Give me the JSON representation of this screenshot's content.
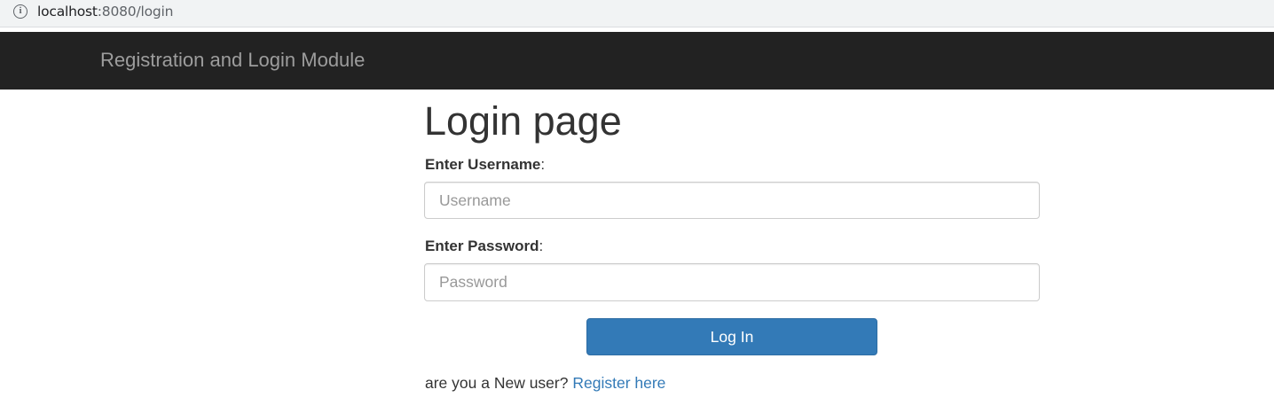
{
  "browser": {
    "url_host": "localhost",
    "url_rest": ":8080/login",
    "info_icon": "info-icon"
  },
  "navbar": {
    "brand": "Registration and Login Module",
    "background": "#222222",
    "brand_color": "#9d9d9d"
  },
  "main": {
    "title": "Login page",
    "username": {
      "label": "Enter Username",
      "colon": ":",
      "placeholder": "Username",
      "value": ""
    },
    "password": {
      "label": "Enter Password",
      "colon": ":",
      "placeholder": "Password",
      "value": ""
    },
    "login_button": "Log In",
    "register": {
      "prompt": "are you a New user?",
      "link_text": "Register here"
    }
  },
  "colors": {
    "primary": "#337ab7",
    "link": "#337ab7",
    "text": "#333333"
  }
}
